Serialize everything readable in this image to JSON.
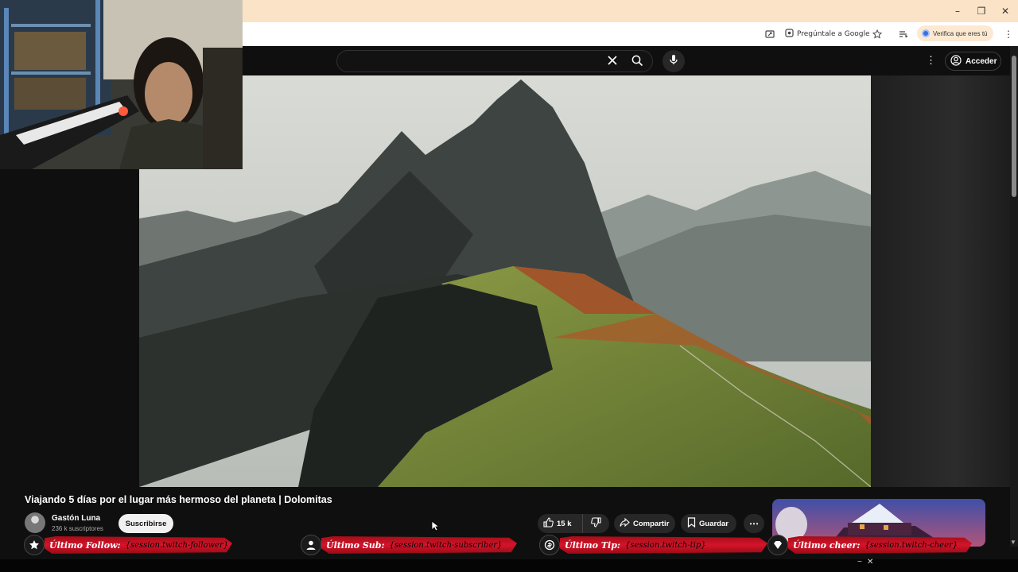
{
  "browser": {
    "window_controls": {
      "minimize": "–",
      "restore": "❐",
      "close": "✕"
    },
    "toolbar": {
      "ask_google_label": "Pregúntale a Google",
      "verify_label": "Verifica que eres tú"
    }
  },
  "youtube": {
    "search": {
      "value": "",
      "clear_icon": "close-icon",
      "search_icon": "search-icon"
    },
    "signin_label": "Acceder",
    "video": {
      "title": "Viajando 5 días por el lugar más hermoso del planeta | Dolomitas",
      "channel_name": "Gastón Luna",
      "subscribers": "236 k suscriptores",
      "subscribe_label": "Suscribirse",
      "likes": "15 k",
      "share_label": "Compartir",
      "save_label": "Guardar"
    }
  },
  "stream_overlay": {
    "banners": [
      {
        "label": "Último Follow:",
        "value": "{session.twitch-follower}"
      },
      {
        "label": "Último Sub:",
        "value": "{session.twitch-subscriber}"
      },
      {
        "label": "Último Tip:",
        "value": "{session.twitch-tip}"
      },
      {
        "label": "Último cheer:",
        "value": "{session.twitch-cheer}"
      }
    ]
  },
  "colors": {
    "titlebar": "#fbe3c8",
    "yt_background": "#0f0f0f",
    "banner_red": "#d4142a"
  }
}
